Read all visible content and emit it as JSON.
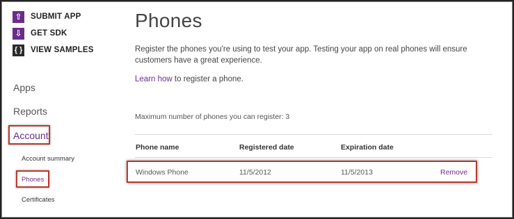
{
  "sdk_links": [
    {
      "label": "SUBMIT APP",
      "icon": "upload-arrow-icon",
      "glyph": "⇧"
    },
    {
      "label": "GET SDK",
      "icon": "download-arrow-icon",
      "glyph": "⇩"
    },
    {
      "label": "VIEW SAMPLES",
      "icon": "braces-icon",
      "glyph": "{ }"
    }
  ],
  "nav": {
    "apps": "Apps",
    "reports": "Reports",
    "account": "Account",
    "sub": {
      "summary": "Account summary",
      "phones": "Phones",
      "certificates": "Certificates"
    }
  },
  "main": {
    "title": "Phones",
    "intro": "Register the phones you're using to test your app. Testing your app on real phones will ensure customers have a great experience.",
    "learn_link": "Learn how",
    "learn_rest": " to register a phone.",
    "max_phones": "Maximum number of phones you can register: 3"
  },
  "table": {
    "headers": [
      "Phone name",
      "Registered date",
      "Expiration date"
    ],
    "rows": [
      {
        "name": "Windows Phone",
        "registered": "11/5/2012",
        "expiration": "11/5/2013",
        "action": "Remove"
      }
    ]
  },
  "colors": {
    "accent": "#6b2d8a",
    "highlight": "#b73a2e"
  }
}
